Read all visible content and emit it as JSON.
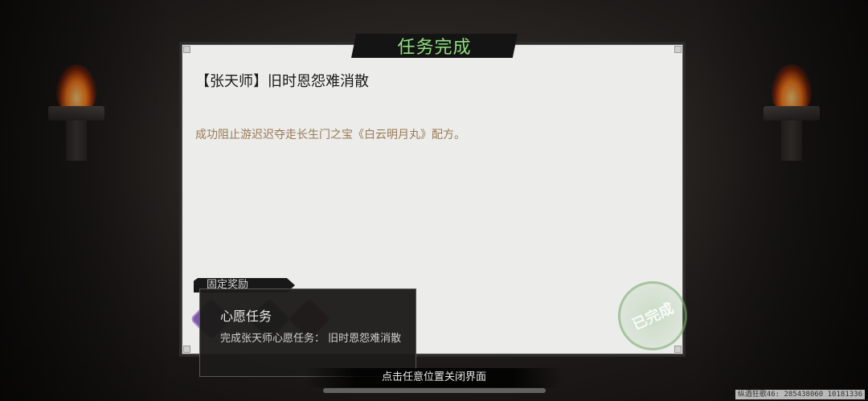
{
  "dialog": {
    "title": "任务完成",
    "quest_name": "【张天师】旧时恩怨难消散",
    "quest_description": "成功阻止游迟迟夺走长生门之宝《白云明月丸》配方。",
    "reward_section_label": "固定奖励",
    "stamp_text": "已完成"
  },
  "tooltip": {
    "title": "心愿任务",
    "text": "完成张天师心愿任务： 旧时恩怨难消散"
  },
  "footer": {
    "close_hint": "点击任意位置关闭界面"
  },
  "watermark": "纵酒狂歌46: 285438060 10181336",
  "colors": {
    "title_green": "#8fe07f",
    "panel_bg": "#ececea",
    "description_brown": "#9a7a55"
  }
}
